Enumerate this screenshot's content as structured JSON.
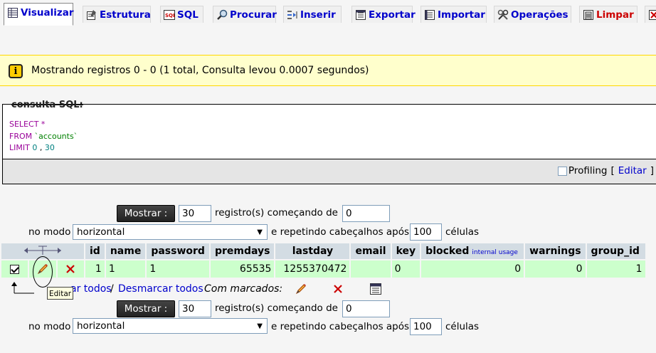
{
  "tabs": [
    {
      "label": "Visualizar",
      "icon": "table-view-icon",
      "active": true
    },
    {
      "label": "Estrutura",
      "icon": "structure-icon"
    },
    {
      "label": "SQL",
      "icon": "sql-icon"
    },
    {
      "label": "Procurar",
      "icon": "search-icon"
    },
    {
      "label": "Inserir",
      "icon": "insert-icon"
    },
    {
      "label": "Exportar",
      "icon": "export-icon"
    },
    {
      "label": "Importar",
      "icon": "import-icon"
    },
    {
      "label": "Operações",
      "icon": "operations-icon"
    },
    {
      "label": "Limpar",
      "icon": "empty-table-icon",
      "danger": true
    }
  ],
  "notice": {
    "text": "Mostrando registros 0 - 0 (1 total, Consulta levou 0.0007 segundos)",
    "icon": "info-icon"
  },
  "sql": {
    "legend": "consulta SQL:",
    "select_kw": "SELECT",
    "select_rest": " *",
    "from_kw": "FROM",
    "from_table": " `accounts`",
    "limit_kw": "LIMIT",
    "limit_a": " 0",
    "limit_sep": " ,",
    "limit_b": " 30",
    "profiling_label": "Profiling",
    "bracket_open": "[",
    "edit_link": "Editar",
    "bracket_close": "]"
  },
  "nav": {
    "show_button": "Mostrar :",
    "rows_value": "30",
    "rows_label": "registro(s) começando de",
    "start_value": "0",
    "mode_label": "no modo",
    "mode_value": "horizontal",
    "repeat_label": "e repetindo cabeçalhos após",
    "repeat_value": "100",
    "cells_label": "células"
  },
  "table": {
    "columns": [
      "id",
      "name",
      "password",
      "premdays",
      "lastday",
      "email",
      "key",
      "blocked",
      "warnings",
      "group_id"
    ],
    "blocked_note": "internal usage",
    "row": [
      "1",
      "1",
      "1",
      "65535",
      "1255370472",
      "",
      "0",
      "0",
      "0",
      "1"
    ]
  },
  "checkall": {
    "mark_all_hidden": "Marcar todos",
    "mark_all_visible": "ar todos",
    "separator": "/",
    "unmark_all": "Desmarcar todos",
    "with_marked": "Com marcados:"
  },
  "tooltip": {
    "text": "Editar"
  },
  "colors": {
    "header_bg": "#d3dce3",
    "row_bg": "#ccffcc",
    "notice_bg": "#ffffcc",
    "link": "#0000cc",
    "danger": "#cc0000"
  }
}
